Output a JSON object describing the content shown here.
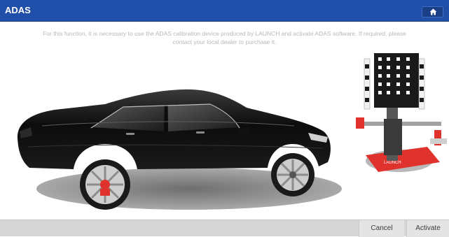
{
  "header": {
    "title": "ADAS",
    "home_icon": "home-icon"
  },
  "message": {
    "line1": "For this function, it is necessary to use the ADAS calibration device produced by LAUNCH and activate ADAS software. If required, please",
    "line2": "contact your local dealer to purchase it."
  },
  "illustration": {
    "rig_brand": "LAUNCH"
  },
  "footer": {
    "cancel_label": "Cancel",
    "activate_label": "Activate"
  },
  "colors": {
    "header_bg": "#1f4fa8",
    "footer_bg": "#d6d6d6",
    "rig_accent": "#e0322c"
  }
}
